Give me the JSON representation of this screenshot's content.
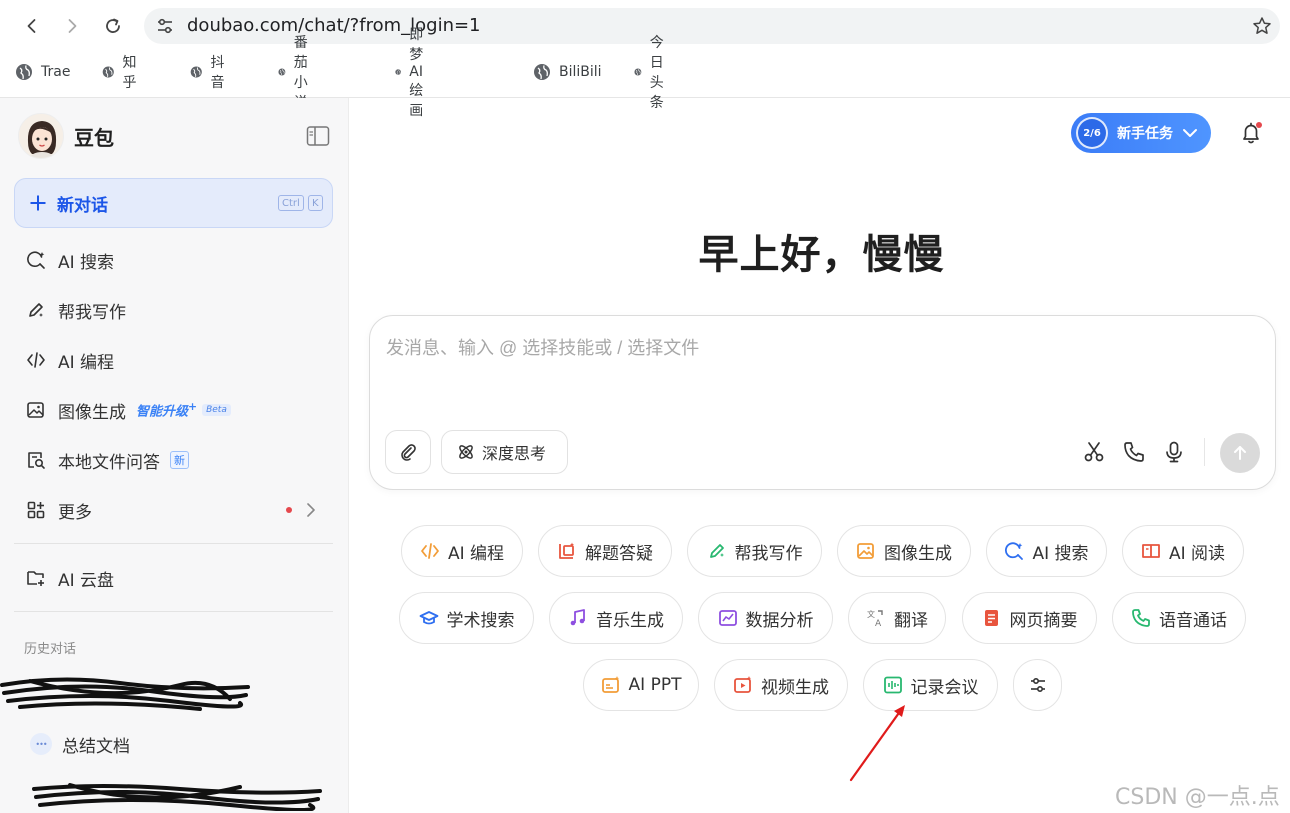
{
  "browser": {
    "url": "doubao.com/chat/?from_login=1",
    "bookmarks": [
      "Trae",
      "知乎",
      "抖音",
      "番茄小说",
      "即梦 AI绘画",
      "BiliBili",
      "今日头条"
    ]
  },
  "sidebar": {
    "brand": "豆包",
    "new_chat": {
      "label": "新对话",
      "shortcut": [
        "Ctrl",
        "K"
      ]
    },
    "items": [
      {
        "label": "AI 搜索",
        "icon": "ai-search-icon"
      },
      {
        "label": "帮我写作",
        "icon": "pen-icon"
      },
      {
        "label": "AI 编程",
        "icon": "code-icon"
      },
      {
        "label": "图像生成",
        "icon": "image-icon",
        "badge": "智能升级",
        "badge_sup": "+",
        "badge2": "Beta"
      },
      {
        "label": "本地文件问答",
        "icon": "file-search-icon",
        "badge": "新"
      },
      {
        "label": "更多",
        "icon": "apps-icon"
      }
    ],
    "cloud": "AI 云盘",
    "history_title": "历史对话",
    "history": [
      {
        "label": "总结文档",
        "bubble": "•••"
      }
    ]
  },
  "header": {
    "task": {
      "progress": "2/6",
      "label": "新手任务"
    }
  },
  "greeting": "早上好，慢慢",
  "composer": {
    "placeholder": "发消息、输入 @ 选择技能或 / 选择文件",
    "deep_think": "深度思考"
  },
  "skills": {
    "row1": [
      "AI 编程",
      "解题答疑",
      "帮我写作",
      "图像生成",
      "AI 搜索",
      "AI 阅读"
    ],
    "row2": [
      "学术搜索",
      "音乐生成",
      "数据分析",
      "翻译",
      "网页摘要",
      "语音通话"
    ],
    "row3": [
      "AI PPT",
      "视频生成",
      "记录会议"
    ]
  },
  "watermark": "CSDN @一点.点",
  "colors": {
    "accent": "#1c56e8",
    "brand_blue": "#3b7cf7",
    "alert": "#e5484d"
  }
}
